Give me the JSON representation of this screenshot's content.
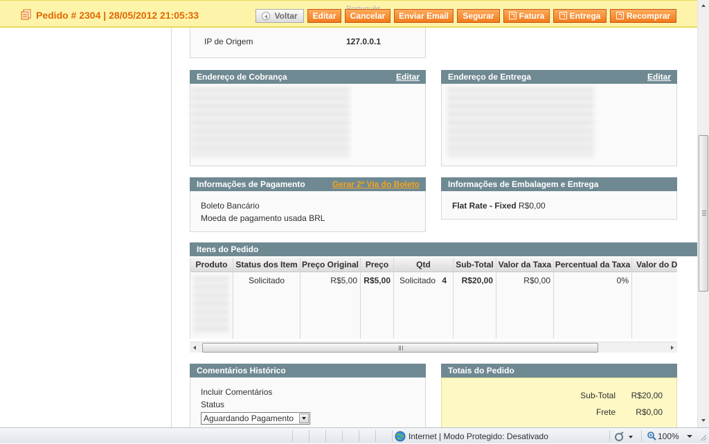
{
  "header": {
    "title": "Pedido # 2304 | 28/05/2012 21:05:33",
    "ghost_text": "Português (Brasil)",
    "buttons": {
      "voltar": "Voltar",
      "editar": "Editar",
      "cancelar": "Cancelar",
      "enviar_email": "Enviar Email",
      "segurar": "Segurar",
      "fatura": "Fatura",
      "entrega": "Entrega",
      "recomprar": "Recomprar"
    }
  },
  "account_info": {
    "ip_label": "IP de Origem",
    "ip_value": "127.0.0.1"
  },
  "billing_address": {
    "title": "Endereço de Cobrança",
    "edit_label": "Editar"
  },
  "shipping_address": {
    "title": "Endereço de Entrega",
    "edit_label": "Editar"
  },
  "payment": {
    "title": "Informações de Pagamento",
    "link_label": "Gerar 2ª Via do Boleto",
    "method": "Boleto Bancário",
    "currency_note": "Moeda de pagamento usada BRL"
  },
  "shipping": {
    "title": "Informações de Embalagem e Entrega",
    "method": "Flat Rate - Fixed",
    "price": "R$0,00"
  },
  "items": {
    "title": "Itens do Pedido",
    "columns": [
      "Produto",
      "Status dos Item",
      "Preço Original",
      "Preço",
      "Qtd",
      "Sub-Total",
      "Valor da Taxa",
      "Percentual da Taxa",
      "Valor do De"
    ],
    "row": {
      "status": "Solicitado",
      "original_price": "R$5,00",
      "price": "R$5,00",
      "qty_label": "Solicitado",
      "qty_value": "4",
      "subtotal": "R$20,00",
      "tax_amount": "R$0,00",
      "tax_percent": "0%"
    }
  },
  "comments": {
    "title": "Comentários Histórico",
    "include_label": "Incluir Comentários",
    "status_label": "Status",
    "status_value": "Aguardando Pagamento"
  },
  "totals": {
    "title": "Totais do Pedido",
    "subtotal_label": "Sub-Total",
    "subtotal_value": "R$20,00",
    "shipping_label": "Frete",
    "shipping_value": "R$0,00"
  },
  "statusbar": {
    "zone_text": "Internet | Modo Protegido: Desativado",
    "zoom": "100%"
  },
  "colors": {
    "header_bg": "#fdf4a9",
    "title_orange": "#e26703",
    "button_orange": "#f27a1b",
    "box_header": "#6f8992",
    "link_orange": "#f7a31a",
    "totals_bg": "#fdf8c4"
  }
}
